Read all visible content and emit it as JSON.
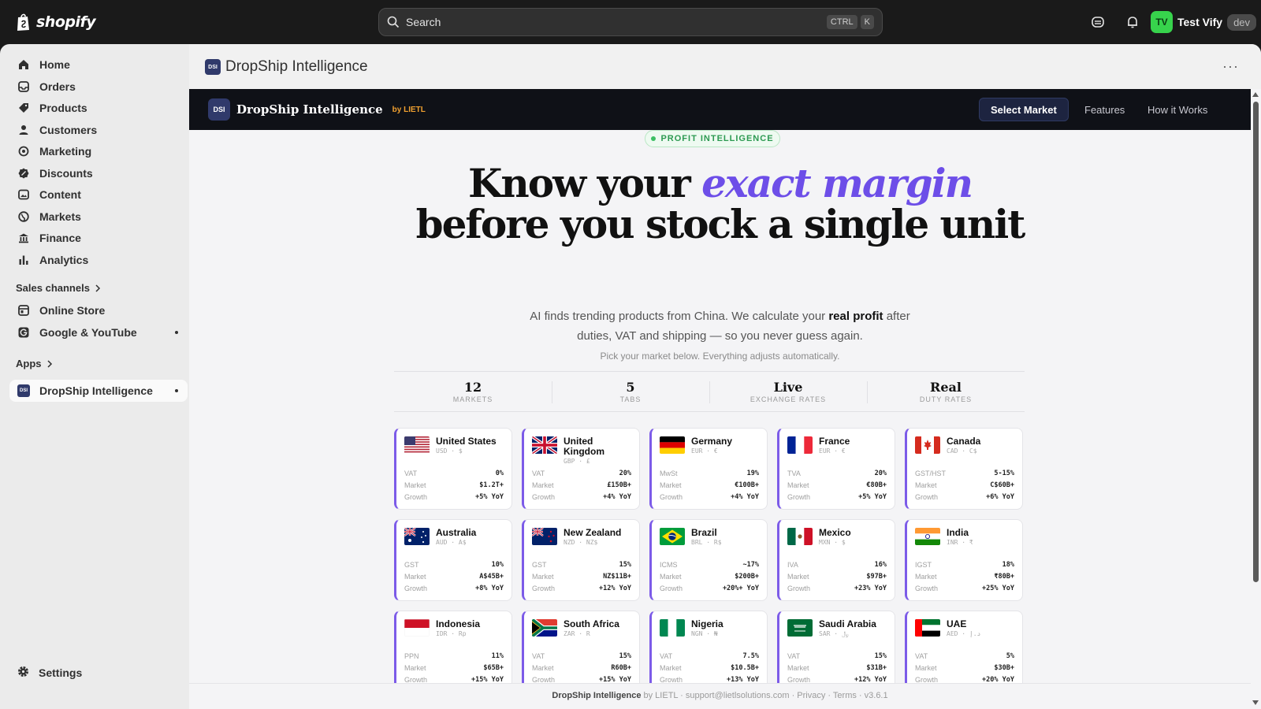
{
  "topbar": {
    "brand": "shopify",
    "search_placeholder": "Search",
    "shortcut_ctrl": "CTRL",
    "shortcut_key": "K",
    "user_initials": "TV",
    "user_name": "Test Vify",
    "env_badge": "dev"
  },
  "sidebar": {
    "items": [
      {
        "label": "Home",
        "icon": "home-icon"
      },
      {
        "label": "Orders",
        "icon": "inbox-icon"
      },
      {
        "label": "Products",
        "icon": "tag-icon"
      },
      {
        "label": "Customers",
        "icon": "person-icon"
      },
      {
        "label": "Marketing",
        "icon": "target-icon"
      },
      {
        "label": "Discounts",
        "icon": "discount-icon"
      },
      {
        "label": "Content",
        "icon": "image-icon"
      },
      {
        "label": "Markets",
        "icon": "globe-icon"
      },
      {
        "label": "Finance",
        "icon": "bank-icon"
      },
      {
        "label": "Analytics",
        "icon": "bar-chart-icon"
      }
    ],
    "sales_channels_label": "Sales channels",
    "channels": [
      {
        "label": "Online Store"
      },
      {
        "label": "Google & YouTube"
      }
    ],
    "apps_label": "Apps",
    "app_item": {
      "label": "DropShip Intelligence",
      "logo": "DSI"
    },
    "settings_label": "Settings"
  },
  "page": {
    "title": "DropShip Intelligence",
    "more": "···"
  },
  "app": {
    "logo": "DSI",
    "brand": "DropShip Intelligence",
    "by": "by LIETL",
    "nav": {
      "select_market": "Select Market",
      "features": "Features",
      "how_it_works": "How it Works"
    },
    "pill": "PROFIT INTELLIGENCE",
    "hero_line1_a": "Know your ",
    "hero_line1_b": "exact margin",
    "hero_line2": "before you stock a single unit",
    "sub_a": "AI finds trending products from China. We calculate your ",
    "sub_b": "real profit",
    "sub_c": " after",
    "sub_line2": "duties, VAT and shipping — so you never guess again.",
    "sub2": "Pick your market below. Everything adjusts automatically.",
    "stats": [
      {
        "value": "12",
        "label": "MARKETS"
      },
      {
        "value": "5",
        "label": "TABS"
      },
      {
        "value": "Live",
        "label": "EXCHANGE RATES"
      },
      {
        "value": "Real",
        "label": "DUTY RATES"
      }
    ],
    "markets": [
      {
        "name": "United States",
        "cur": "USD · $",
        "tax_label": "VAT",
        "tax": "0%",
        "market": "$1.2T+",
        "growth": "+5% YoY",
        "flag": "us"
      },
      {
        "name": "United Kingdom",
        "cur": "GBP · £",
        "tax_label": "VAT",
        "tax": "20%",
        "market": "£150B+",
        "growth": "+4% YoY",
        "flag": "gb"
      },
      {
        "name": "Germany",
        "cur": "EUR · €",
        "tax_label": "MwSt",
        "tax": "19%",
        "market": "€100B+",
        "growth": "+4% YoY",
        "flag": "de"
      },
      {
        "name": "France",
        "cur": "EUR · €",
        "tax_label": "TVA",
        "tax": "20%",
        "market": "€80B+",
        "growth": "+5% YoY",
        "flag": "fr"
      },
      {
        "name": "Canada",
        "cur": "CAD · C$",
        "tax_label": "GST/HST",
        "tax": "5-15%",
        "market": "C$60B+",
        "growth": "+6% YoY",
        "flag": "ca"
      },
      {
        "name": "Australia",
        "cur": "AUD · A$",
        "tax_label": "GST",
        "tax": "10%",
        "market": "A$45B+",
        "growth": "+8% YoY",
        "flag": "au"
      },
      {
        "name": "New Zealand",
        "cur": "NZD · NZ$",
        "tax_label": "GST",
        "tax": "15%",
        "market": "NZ$11B+",
        "growth": "+12% YoY",
        "flag": "nz"
      },
      {
        "name": "Brazil",
        "cur": "BRL · R$",
        "tax_label": "ICMS",
        "tax": "~17%",
        "market": "$200B+",
        "growth": "+20%+ YoY",
        "flag": "br"
      },
      {
        "name": "Mexico",
        "cur": "MXN · $",
        "tax_label": "IVA",
        "tax": "16%",
        "market": "$97B+",
        "growth": "+23% YoY",
        "flag": "mx"
      },
      {
        "name": "India",
        "cur": "INR · ₹",
        "tax_label": "IGST",
        "tax": "18%",
        "market": "₹80B+",
        "growth": "+25% YoY",
        "flag": "in"
      },
      {
        "name": "Indonesia",
        "cur": "IDR · Rp",
        "tax_label": "PPN",
        "tax": "11%",
        "market": "$65B+",
        "growth": "+15% YoY",
        "flag": "id"
      },
      {
        "name": "South Africa",
        "cur": "ZAR · R",
        "tax_label": "VAT",
        "tax": "15%",
        "market": "R60B+",
        "growth": "+15% YoY",
        "flag": "za"
      },
      {
        "name": "Nigeria",
        "cur": "NGN · ₦",
        "tax_label": "VAT",
        "tax": "7.5%",
        "market": "$10.5B+",
        "growth": "+13% YoY",
        "flag": "ng"
      },
      {
        "name": "Saudi Arabia",
        "cur": "SAR · ﷼",
        "tax_label": "VAT",
        "tax": "15%",
        "market": "$31B+",
        "growth": "+12% YoY",
        "flag": "sa"
      },
      {
        "name": "UAE",
        "cur": "AED · د.إ",
        "tax_label": "VAT",
        "tax": "5%",
        "market": "$30B+",
        "growth": "+20% YoY",
        "flag": "ae"
      }
    ],
    "row_labels": {
      "market": "Market",
      "growth": "Growth"
    },
    "footer": {
      "brand": "DropShip Intelligence",
      "rest": " by LIETL · support@lietlsolutions.com · Privacy · Terms · v3.6.1"
    }
  }
}
